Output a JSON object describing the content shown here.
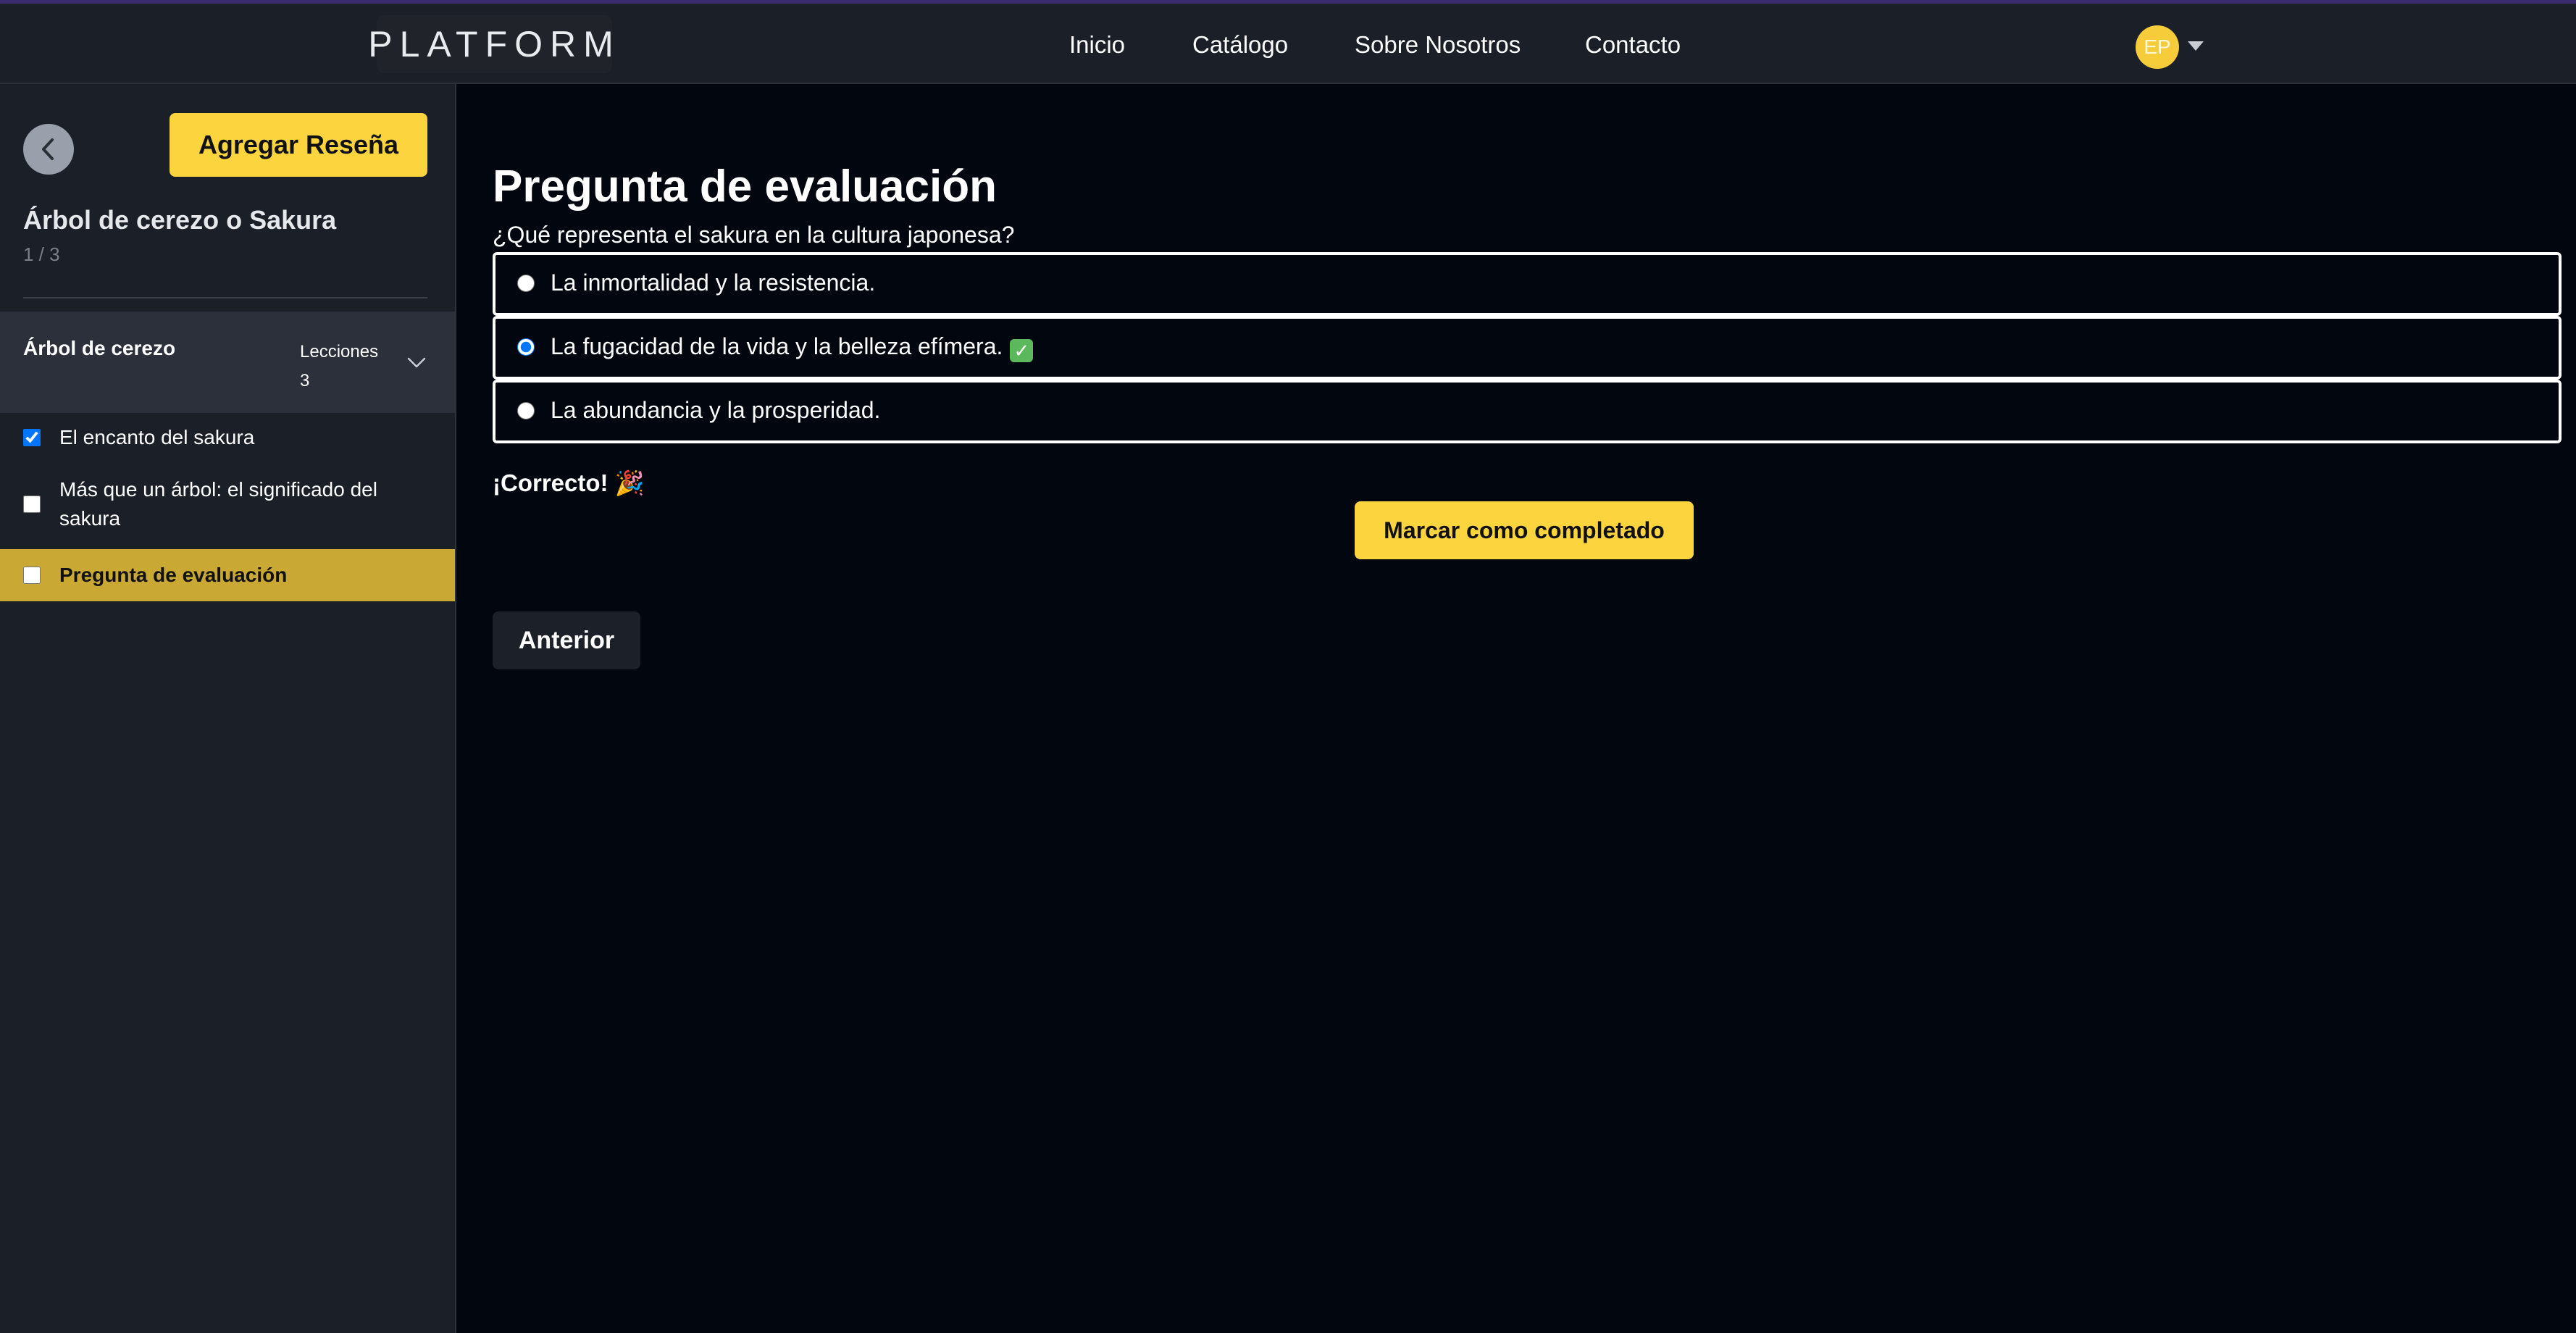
{
  "header": {
    "logo": "PLATFORM",
    "nav": [
      "Inicio",
      "Catálogo",
      "Sobre Nosotros",
      "Contacto"
    ],
    "avatar_initials": "EP",
    "accent_color": "#fcd53e"
  },
  "sidebar": {
    "review_button": "Agregar Reseña",
    "course_title": "Árbol de cerezo o Sakura",
    "progress": "1 / 3",
    "section": {
      "title": "Árbol de cerezo",
      "lessons_label": "Lecciones",
      "lessons_count": "3"
    },
    "lessons": [
      {
        "label": "El encanto del sakura",
        "checked": true,
        "active": false
      },
      {
        "label": "Más que un árbol: el significado del sakura",
        "checked": false,
        "active": false
      },
      {
        "label": "Pregunta de evaluación",
        "checked": false,
        "active": true
      }
    ]
  },
  "main": {
    "title": "Pregunta de evaluación",
    "question": "¿Qué representa el sakura en la cultura japonesa?",
    "options": [
      {
        "label": "La inmortalidad y la resistencia.",
        "selected": false
      },
      {
        "label": "La fugacidad de la vida y la belleza efímera.",
        "selected": true
      },
      {
        "label": "La abundancia y la prosperidad.",
        "selected": false
      }
    ],
    "feedback": "¡Correcto! 🎉",
    "complete_button": "Marcar como completado",
    "prev_button": "Anterior"
  }
}
